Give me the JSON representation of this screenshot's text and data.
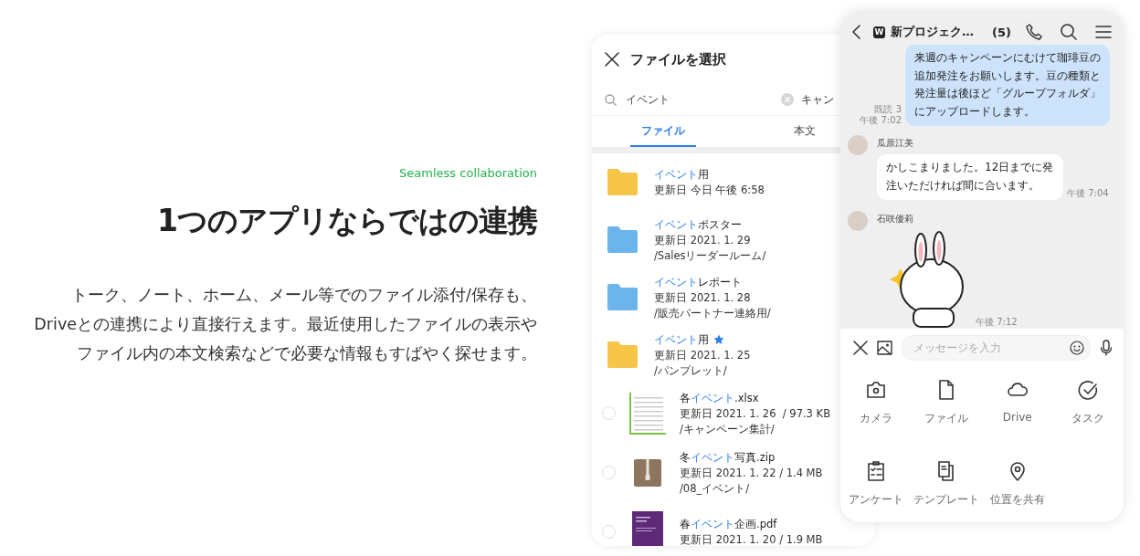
{
  "intro": {
    "eyebrow": "Seamless collaboration",
    "heading": "1つのアプリならではの連携",
    "body_lines": [
      "トーク、ノート、ホーム、メール等でのファイル添付/保存も、",
      "Driveとの連携により直接行えます。最近使用したファイルの表示や",
      "ファイル内の本文検索などで必要な情報もすばやく探せます。"
    ]
  },
  "file_picker": {
    "title": "ファイルを選択",
    "search": {
      "value": "イベント",
      "cancel": "キャン"
    },
    "tabs": [
      {
        "label": "ファイル",
        "selected": true
      },
      {
        "label": "本文",
        "selected": false
      }
    ],
    "items": [
      {
        "kind": "folder",
        "color": "#f7c548",
        "starred": false,
        "name": [
          {
            "text": "イベント",
            "match": true
          },
          {
            "text": "用",
            "match": false
          }
        ],
        "lines": [
          "更新日 今日 午後 6:58"
        ]
      },
      {
        "kind": "folder",
        "color": "#6cb4ec",
        "starred": false,
        "name": [
          {
            "text": "イベント",
            "match": true
          },
          {
            "text": "ポスター",
            "match": false
          }
        ],
        "lines": [
          "更新日 2021. 1. 29",
          "/Salesリーダールーム/"
        ]
      },
      {
        "kind": "folder",
        "color": "#6cb4ec",
        "starred": false,
        "name": [
          {
            "text": "イベント",
            "match": true
          },
          {
            "text": "レポート",
            "match": false
          }
        ],
        "lines": [
          "更新日 2021. 1. 28",
          "/販売パートナー連絡用/"
        ]
      },
      {
        "kind": "folder",
        "color": "#f7c548",
        "starred": true,
        "name": [
          {
            "text": "イベント",
            "match": true
          },
          {
            "text": "用",
            "match": false
          }
        ],
        "lines": [
          "更新日 2021. 1. 25",
          "/パンプレット/"
        ]
      },
      {
        "kind": "spreadsheet",
        "selected": false,
        "name": [
          {
            "text": "各",
            "match": false
          },
          {
            "text": "イベント",
            "match": true
          },
          {
            "text": ".xlsx",
            "match": false
          }
        ],
        "lines": [
          "更新日 2021. 1. 26  / 97.3 KB",
          "/キャンペーン集計/"
        ]
      },
      {
        "kind": "archive",
        "selected": false,
        "name": [
          {
            "text": "冬",
            "match": false
          },
          {
            "text": "イベント",
            "match": true
          },
          {
            "text": "写真.zip",
            "match": false
          }
        ],
        "lines": [
          "更新日 2021. 1. 22 / 1.4 MB",
          "/08_イベント/"
        ]
      },
      {
        "kind": "document",
        "selected": false,
        "name": [
          {
            "text": "春",
            "match": false
          },
          {
            "text": "イベント",
            "match": true
          },
          {
            "text": "企画.pdf",
            "match": false
          }
        ],
        "lines": [
          "更新日 2021. 1. 20 / 1.9 MB"
        ]
      }
    ]
  },
  "chat": {
    "logo": "W",
    "title": "新プロジェク…",
    "count": "(5)",
    "messages": [
      {
        "kind": "outgoing",
        "text": "来週のキャンペーンにむけて珈琲豆の追加発注をお願いします。豆の種類と発注量は後ほど「グループフォルダ」にアップロードします。",
        "read": "既読 3",
        "time": "午後 7:02"
      },
      {
        "kind": "incoming",
        "sender": "瓜原江美",
        "text": "かしこまりました。12日までに発注いただければ間に合います。",
        "time": "午後 7:04"
      },
      {
        "kind": "sticker",
        "sender": "石咲優莉",
        "time": "午後 7:12"
      }
    ],
    "input": {
      "placeholder": "メッセージを入力"
    },
    "attachments": [
      {
        "kind": "camera",
        "label": "カメラ"
      },
      {
        "kind": "file",
        "label": "ファイル"
      },
      {
        "kind": "drive",
        "label": "Drive"
      },
      {
        "kind": "task",
        "label": "タスク"
      },
      {
        "kind": "survey",
        "label": "アンケート"
      },
      {
        "kind": "template",
        "label": "テンプレート"
      },
      {
        "kind": "location",
        "label": "位置を共有"
      }
    ]
  }
}
